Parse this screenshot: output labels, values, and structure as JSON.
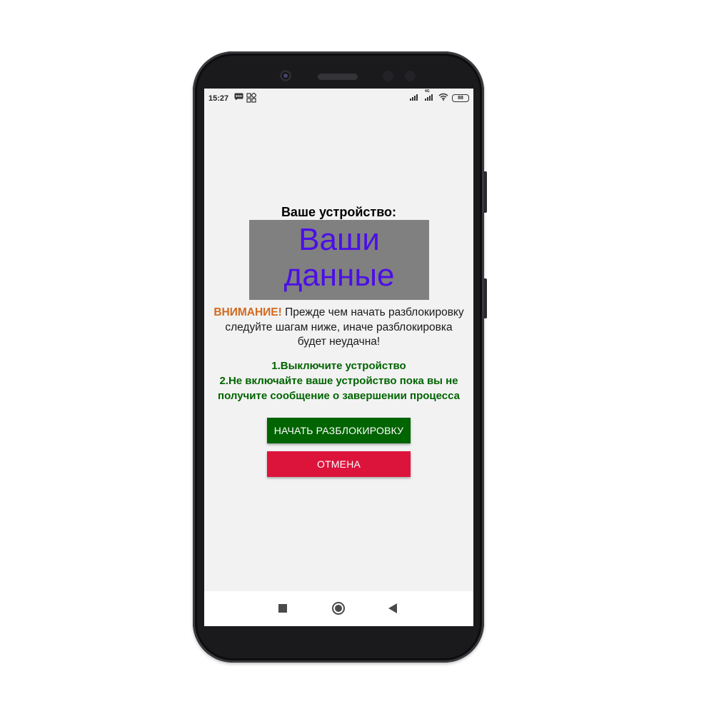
{
  "status_bar": {
    "time": "15:27",
    "battery": "88",
    "network_label": "4G",
    "icons": [
      "message-icon",
      "qr-app-icon",
      "signal-icon",
      "signal-4g-icon",
      "wifi-icon",
      "battery-icon"
    ]
  },
  "screen": {
    "heading": "Ваше устройство:",
    "data_box_line1": "Ваши",
    "data_box_line2": "данные",
    "warning_label": "ВНИМАНИЕ!",
    "warning_text": " Прежде чем начать разблокировку следуйте шагам ниже, иначе разблокировка будет неудачна!",
    "step1": "1.Выключите устройство",
    "step2": "2.Не включайте ваше устройство пока вы не получите сообщение о завершении процесса",
    "start_button": "НАЧАТЬ РАЗБЛОКИРОВКУ",
    "cancel_button": "ОТМЕНА"
  },
  "colors": {
    "heading": "#000000",
    "data_box_bg": "#808080",
    "data_box_text": "#4b0fe6",
    "warning_label": "#d2691e",
    "steps": "#006400",
    "start_button": "#006400",
    "cancel_button": "#dc143c",
    "screen_bg": "#f2f2f2"
  },
  "nav_bar": {
    "icons": [
      "recents-square-icon",
      "home-circle-icon",
      "back-triangle-icon"
    ]
  }
}
